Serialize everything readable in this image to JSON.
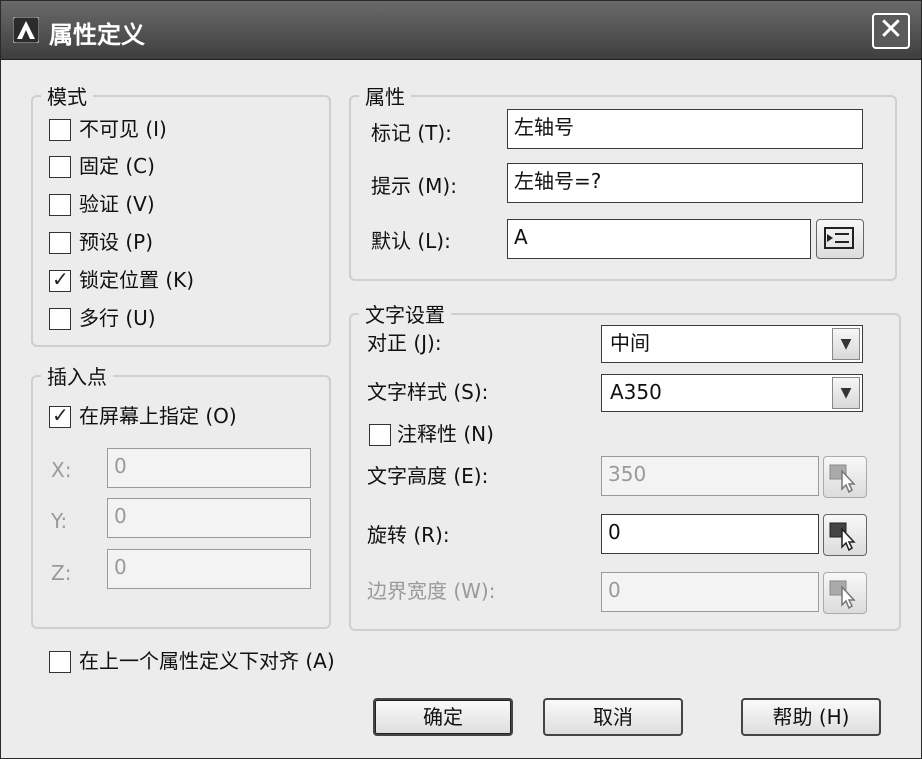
{
  "window": {
    "title": "属性定义",
    "close_glyph": "✕"
  },
  "mode": {
    "legend": "模式",
    "options": [
      {
        "label": "不可见 (I)",
        "checked": false
      },
      {
        "label": "固定 (C)",
        "checked": false
      },
      {
        "label": "验证 (V)",
        "checked": false
      },
      {
        "label": "预设 (P)",
        "checked": false
      },
      {
        "label": "锁定位置 (K)",
        "checked": true
      },
      {
        "label": "多行 (U)",
        "checked": false
      }
    ]
  },
  "insertion_point": {
    "legend": "插入点",
    "on_screen_label": "在屏幕上指定 (O)",
    "on_screen_checked": true,
    "x_label": "X:",
    "x_value": "0",
    "y_label": "Y:",
    "y_value": "0",
    "z_label": "Z:",
    "z_value": "0"
  },
  "attribute": {
    "legend": "属性",
    "tag_label": "标记 (T):",
    "tag_value": "左轴号",
    "prompt_label": "提示 (M):",
    "prompt_value": "左轴号=?",
    "default_label": "默认 (L):",
    "default_value": "A"
  },
  "text_settings": {
    "legend": "文字设置",
    "justify_label": "对正 (J):",
    "justify_value": "中间",
    "style_label": "文字样式 (S):",
    "style_value": "A350",
    "annotative_label": "注释性 (N)",
    "annotative_checked": false,
    "height_label": "文字高度 (E):",
    "height_value": "350",
    "rotation_label": "旋转 (R):",
    "rotation_value": "0",
    "boundary_label": "边界宽度 (W):",
    "boundary_value": "0"
  },
  "align_below": {
    "label": "在上一个属性定义下对齐 (A)",
    "checked": false
  },
  "buttons": {
    "ok": "确定",
    "cancel": "取消",
    "help": "帮助 (H)"
  },
  "colors": {
    "titlebar": "#4a4a4a",
    "face": "#ececec",
    "disabled_text": "#9a9a9a"
  }
}
